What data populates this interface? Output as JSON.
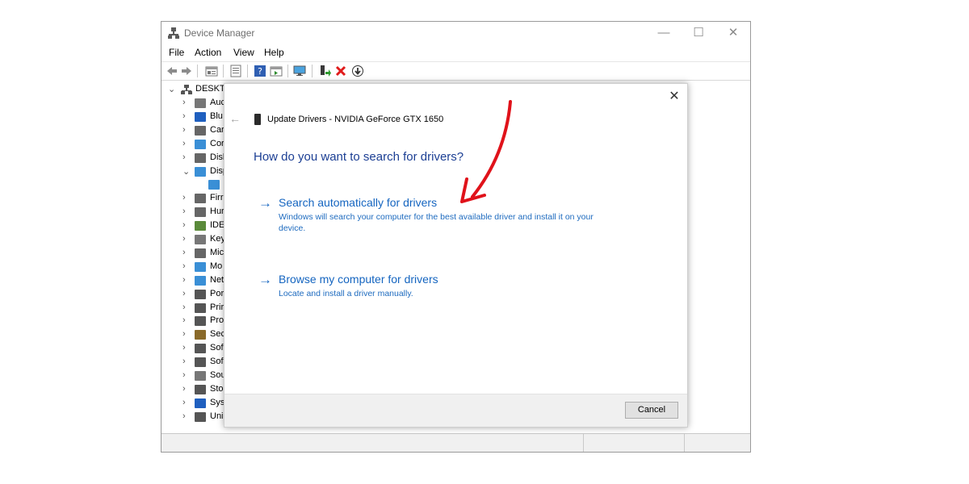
{
  "window": {
    "title": "Device Manager",
    "controls": {
      "minimize": "—",
      "maximize": "☐",
      "close": "✕"
    }
  },
  "menu": [
    "File",
    "Action",
    "View",
    "Help"
  ],
  "toolbar_icons": [
    "back-arrow-icon",
    "forward-arrow-icon",
    "properties-icon",
    "console-tree-icon",
    "help-icon",
    "action-pane-icon",
    "scan-monitor-icon",
    "update-driver-icon",
    "uninstall-x-icon",
    "disable-device-icon"
  ],
  "tree": {
    "root": "DESKTC",
    "items": [
      "Auc",
      "Blu",
      "Car",
      "Cor",
      "Disl",
      "Disp",
      "",
      "Firr",
      "Hur",
      "IDE",
      "Key",
      "Mic",
      "Mo",
      "Net",
      "Por",
      "Prir",
      "Pro",
      "Sec",
      "Sof",
      "Sof",
      "Sou",
      "Sto",
      "Sys",
      "Uni"
    ]
  },
  "dialog": {
    "close": "✕",
    "back": "←",
    "title": "Update Drivers - NVIDIA GeForce GTX 1650",
    "heading": "How do you want to search for drivers?",
    "options": [
      {
        "arrow": "→",
        "title": "Search automatically for drivers",
        "description": "Windows will search your computer for the best available driver and install it on your device."
      },
      {
        "arrow": "→",
        "title": "Browse my computer for drivers",
        "description": "Locate and install a driver manually."
      }
    ],
    "cancel": "Cancel"
  },
  "colors": {
    "link": "#1565c0",
    "heading": "#1c3f94",
    "annotation": "#e0121a"
  }
}
